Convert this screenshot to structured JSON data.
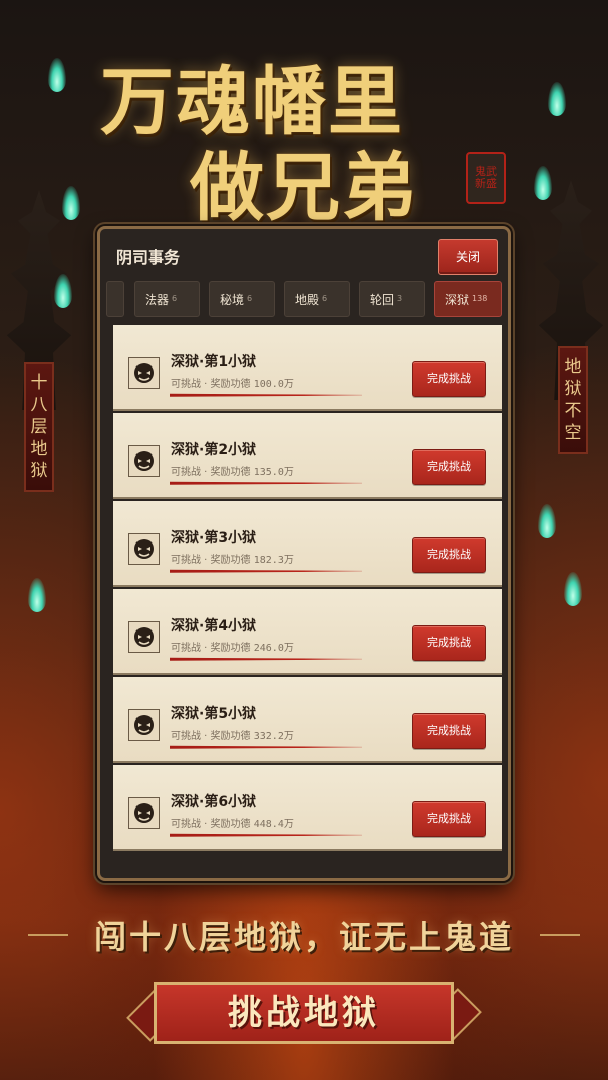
{
  "poster": {
    "title_line1": "万魂幡里",
    "title_line2": "做兄弟",
    "seal_text": "鬼武新盛",
    "banner_left": "十八层地狱",
    "banner_right": "地狱不空",
    "slogan": "闯十八层地狱，证无上鬼道",
    "cta": "挑战地狱"
  },
  "panel": {
    "title": "阴司事务",
    "close_label": "关闭",
    "tabs": [
      {
        "label": "法器",
        "count": "6",
        "active": false
      },
      {
        "label": "秘境",
        "count": "6",
        "active": false
      },
      {
        "label": "地殿",
        "count": "6",
        "active": false
      },
      {
        "label": "轮回",
        "count": "3",
        "active": false
      },
      {
        "label": "深狱",
        "count": "138",
        "active": true
      }
    ],
    "tasks": [
      {
        "title": "深狱·第1小狱",
        "status": "可挑战",
        "reward_label": "奖励功德",
        "reward": "100.0万",
        "button": "完成挑战"
      },
      {
        "title": "深狱·第2小狱",
        "status": "可挑战",
        "reward_label": "奖励功德",
        "reward": "135.0万",
        "button": "完成挑战"
      },
      {
        "title": "深狱·第3小狱",
        "status": "可挑战",
        "reward_label": "奖励功德",
        "reward": "182.3万",
        "button": "完成挑战"
      },
      {
        "title": "深狱·第4小狱",
        "status": "可挑战",
        "reward_label": "奖励功德",
        "reward": "246.0万",
        "button": "完成挑战"
      },
      {
        "title": "深狱·第5小狱",
        "status": "可挑战",
        "reward_label": "奖励功德",
        "reward": "332.2万",
        "button": "完成挑战"
      },
      {
        "title": "深狱·第6小狱",
        "status": "可挑战",
        "reward_label": "奖励功德",
        "reward": "448.4万",
        "button": "完成挑战"
      }
    ]
  },
  "colors": {
    "accent_red": "#b3261c",
    "gold": "#f0cf7a",
    "ghost_fire": "#3fd4b0"
  },
  "icons": {
    "task_emblem": "demon-face-icon"
  }
}
